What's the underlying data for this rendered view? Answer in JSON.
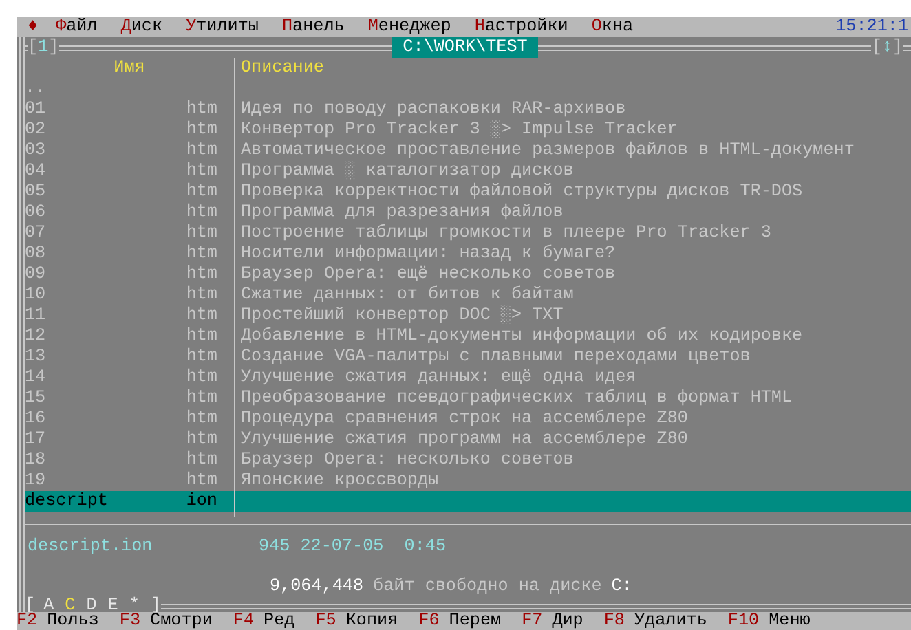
{
  "menu_bar": {
    "items": [
      {
        "label": "♦"
      },
      {
        "label": "Файл"
      },
      {
        "label": "Диск"
      },
      {
        "label": "Утилиты"
      },
      {
        "label": "Панель"
      },
      {
        "label": "Менеджер"
      },
      {
        "label": "Настройки"
      },
      {
        "label": "Окна"
      }
    ],
    "clock": "15:21:1"
  },
  "panel": {
    "window_number": {
      "open": "[",
      "number": "1",
      "close": "]"
    },
    "path": "C:\\WORK\\TEST",
    "sort_toggle": {
      "open": "[",
      "icon": "↕",
      "close": "]"
    },
    "columns": [
      "Имя",
      "Описание"
    ],
    "files": [
      {
        "name": "..",
        "selected": false
      },
      {
        "name": "01",
        "ext": "htm",
        "description": "Идея по поводу распаковки RAR-архивов",
        "selected": false
      },
      {
        "name": "02",
        "ext": "htm",
        "description": "Конвертор Pro Tracker 3 ░> Impulse Tracker",
        "selected": false
      },
      {
        "name": "03",
        "ext": "htm",
        "description": "Автоматическое проставление размеров файлов в HTML-документ",
        "selected": false
      },
      {
        "name": "04",
        "ext": "htm",
        "description": "Программа ░ каталогизатор дисков",
        "selected": false
      },
      {
        "name": "05",
        "ext": "htm",
        "description": "Проверка корректности файловой структуры дисков TR-DOS",
        "selected": false
      },
      {
        "name": "06",
        "ext": "htm",
        "description": "Программа для разрезания файлов",
        "selected": false
      },
      {
        "name": "07",
        "ext": "htm",
        "description": "Построение таблицы громкости в плеере Pro Tracker 3",
        "selected": false
      },
      {
        "name": "08",
        "ext": "htm",
        "description": "Носители информации: назад к бумаге?",
        "selected": false
      },
      {
        "name": "09",
        "ext": "htm",
        "description": "Браузер Opera: ещё несколько советов",
        "selected": false
      },
      {
        "name": "10",
        "ext": "htm",
        "description": "Сжатие данных: от битов к байтам",
        "selected": false
      },
      {
        "name": "11",
        "ext": "htm",
        "description": "Простейший конвертор DOC ░> TXT",
        "selected": false
      },
      {
        "name": "12",
        "ext": "htm",
        "description": "Добавление в HTML-документы информации об их кодировке",
        "selected": false
      },
      {
        "name": "13",
        "ext": "htm",
        "description": "Создание VGA-палитры с плавными переходами цветов",
        "selected": false
      },
      {
        "name": "14",
        "ext": "htm",
        "description": "Улучшение сжатия данных: ещё одна идея",
        "selected": false
      },
      {
        "name": "15",
        "ext": "htm",
        "description": "Преобразование псевдографических таблиц в формат HTML",
        "selected": false
      },
      {
        "name": "16",
        "ext": "htm",
        "description": "Процедура сравнения строк на ассемблере Z80",
        "selected": false
      },
      {
        "name": "17",
        "ext": "htm",
        "description": "Улучшение сжатия программ на ассемблере Z80",
        "selected": false
      },
      {
        "name": "18",
        "ext": "htm",
        "description": "Браузер Opera: несколько советов",
        "selected": false
      },
      {
        "name": "19",
        "ext": "htm",
        "description": "Японские кроссворды",
        "selected": false
      },
      {
        "name": "descript",
        "ext": "ion",
        "selected": true
      }
    ],
    "info": {
      "file": "descript.ion",
      "details": "945 22-07-05  0:45"
    },
    "free_space": {
      "bytes": "9,064,448",
      "label": "байт свободно на диске",
      "drive": "C:"
    },
    "drives": {
      "open": "[",
      "items": [
        {
          "letter": "A",
          "selected": false
        },
        {
          "letter": "C",
          "selected": true
        },
        {
          "letter": "D",
          "selected": false
        },
        {
          "letter": "E",
          "selected": false
        },
        {
          "letter": "*",
          "selected": false
        }
      ],
      "close": "]"
    }
  },
  "function_keys": [
    {
      "key": "F2",
      "label": "Польз"
    },
    {
      "key": "F3",
      "label": "Смотри"
    },
    {
      "key": "F4",
      "label": "Ред"
    },
    {
      "key": "F5",
      "label": "Копия"
    },
    {
      "key": "F6",
      "label": "Перем"
    },
    {
      "key": "F7",
      "label": "Дир"
    },
    {
      "key": "F8",
      "label": "Удалить"
    },
    {
      "key": "F10",
      "label": "Меню"
    }
  ]
}
